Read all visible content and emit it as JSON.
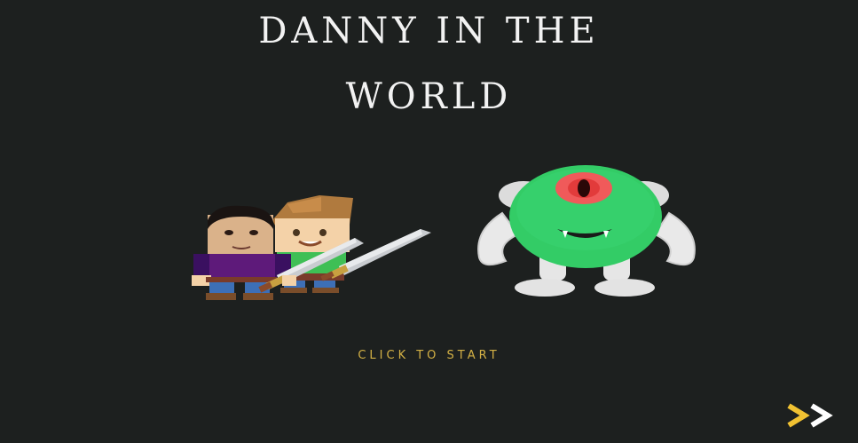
{
  "game": {
    "title_line1": "DANNY IN THE",
    "title_line2": "WORLD",
    "start_label": "CLICK TO START"
  },
  "colors": {
    "background": "#1d201f",
    "title": "#f2f2f2",
    "start_text": "#d4b145",
    "next_chevron_1": "#f1c232",
    "next_chevron_2": "#ffffff",
    "monster_body": "#33cc66"
  },
  "icons": {
    "next": "double-chevron-right-icon"
  }
}
